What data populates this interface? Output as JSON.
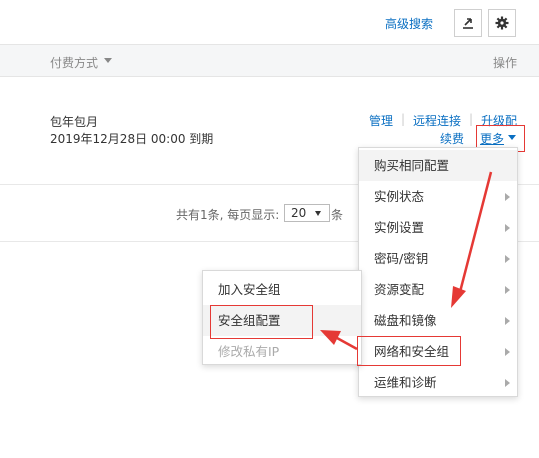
{
  "toolbar": {
    "advanced_search": "高级搜索",
    "export_icon": "export-icon",
    "settings_icon": "gear-icon"
  },
  "table": {
    "columns": {
      "payment": "付费方式",
      "operations": "操作"
    },
    "row": {
      "payment_type": "包年包月",
      "expire": "2019年12月28日 00:00 到期",
      "ops": {
        "manage": "管理",
        "remote": "远程连接",
        "upgrade": "升级配",
        "renew": "续费",
        "more": "更多"
      }
    }
  },
  "pagination": {
    "summary": "共有1条, 每页显示:",
    "page_size": "20",
    "unit": "条"
  },
  "more_menu": {
    "items": [
      "购买相同配置",
      "实例状态",
      "实例设置",
      "密码/密钥",
      "资源变配",
      "磁盘和镜像",
      "网络和安全组",
      "运维和诊断"
    ]
  },
  "sg_menu": {
    "items": [
      "加入安全组",
      "安全组配置",
      "修改私有IP"
    ]
  },
  "colors": {
    "link": "#0a6fc2",
    "highlight": "#e53935"
  }
}
